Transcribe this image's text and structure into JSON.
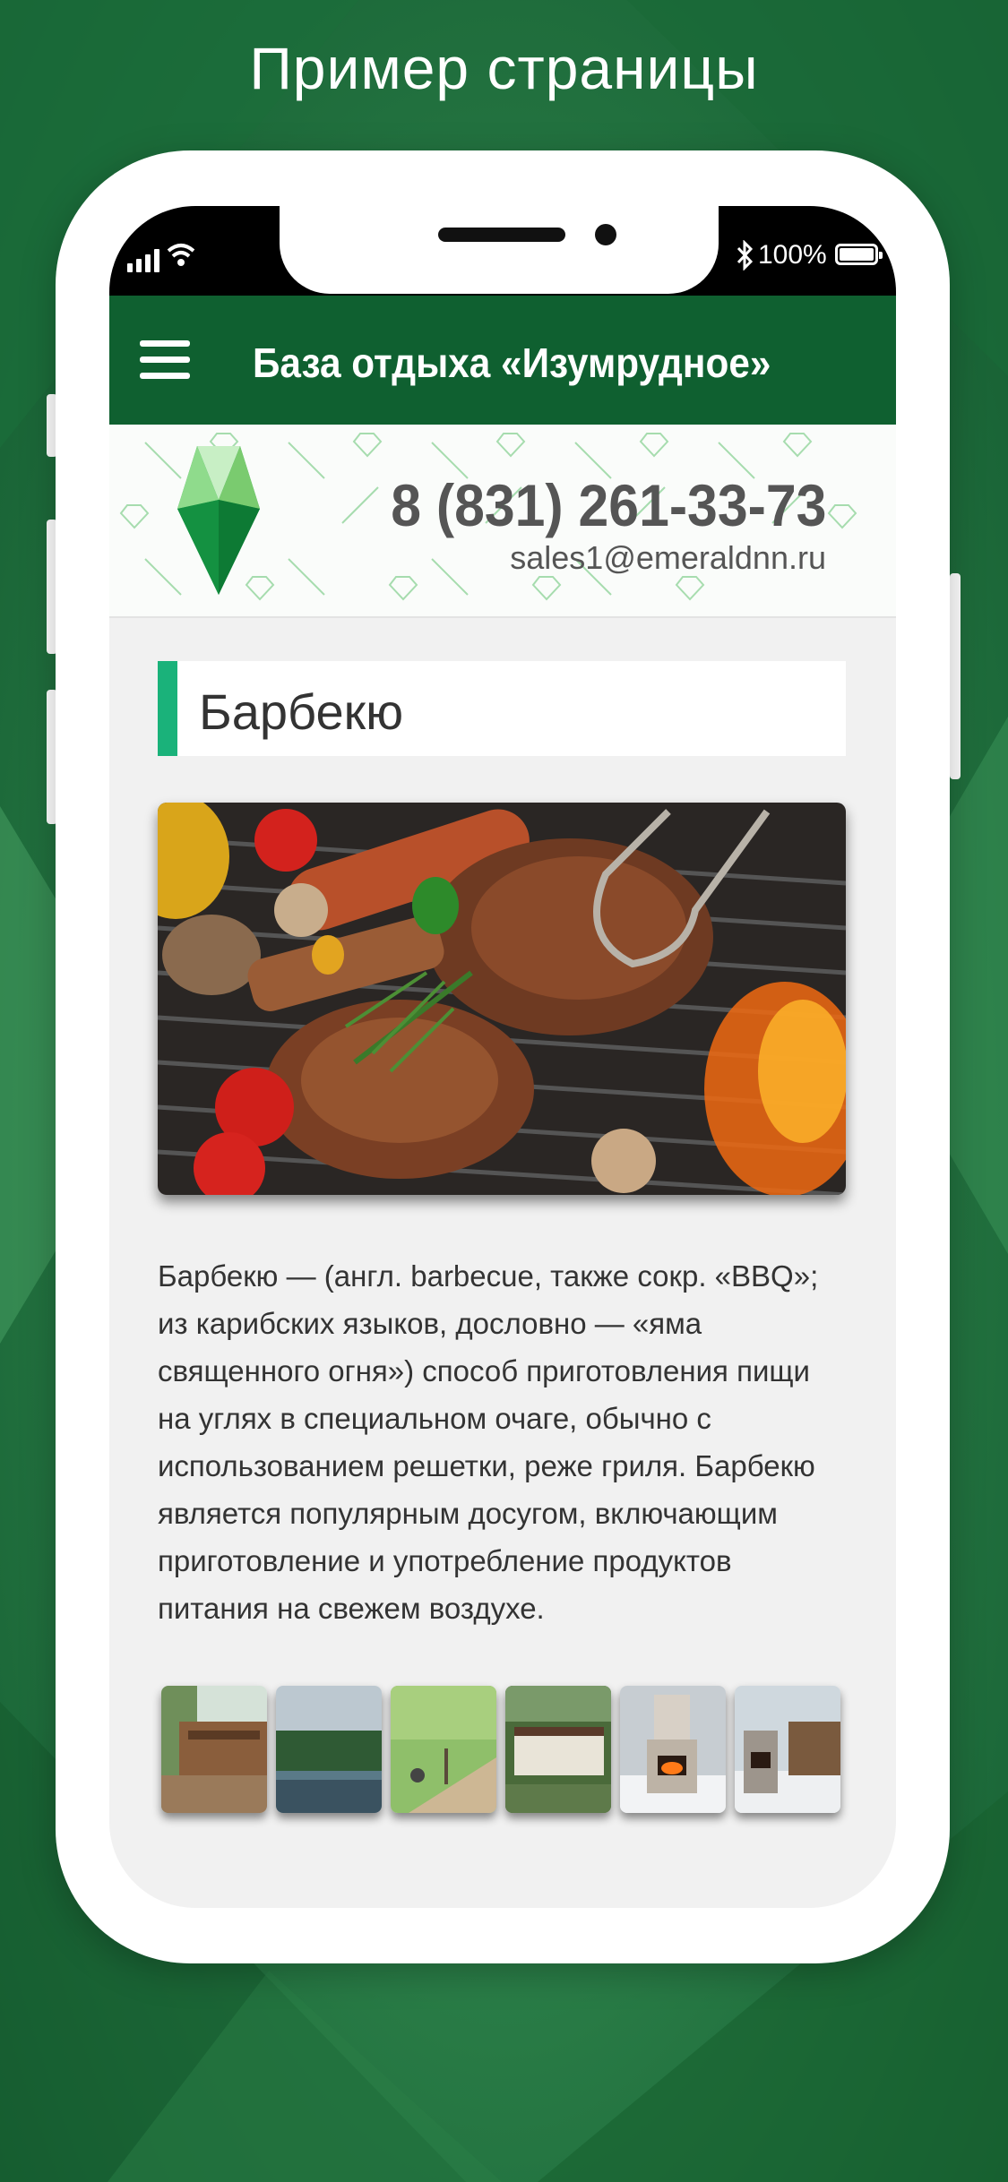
{
  "promo": {
    "title": "Пример страницы"
  },
  "status_bar": {
    "battery_percent": "100%",
    "icons": [
      "signal-icon",
      "wifi-icon",
      "bluetooth-icon",
      "battery-icon"
    ]
  },
  "app_bar": {
    "title": "База отдыха «Изумрудное»",
    "menu_icon": "hamburger-icon"
  },
  "brand": {
    "phone": "8 (831) 261-33-73",
    "email": "sales1@emeraldnn.ru",
    "logo_icon": "emerald-logo-icon"
  },
  "section": {
    "title": "Барбекю"
  },
  "article": {
    "lines": [
      "Барбекю — (англ. barbecue, также сокр. «BBQ»;",
      "из карибских языков, дословно — «яма",
      "священного огня») способ приготовления пищи",
      "на углях в специальном очаге, обычно с",
      "использованием решетки, реже гриля. Барбекю",
      "является популярным досугом, включающим",
      "приготовление и употребление продуктов",
      "питания на свежем воздухе."
    ]
  },
  "gallery": {
    "thumbnails": 6
  },
  "colors": {
    "app_bar": "#0f6030",
    "accent": "#1ab27a",
    "background": "#2c8049"
  }
}
